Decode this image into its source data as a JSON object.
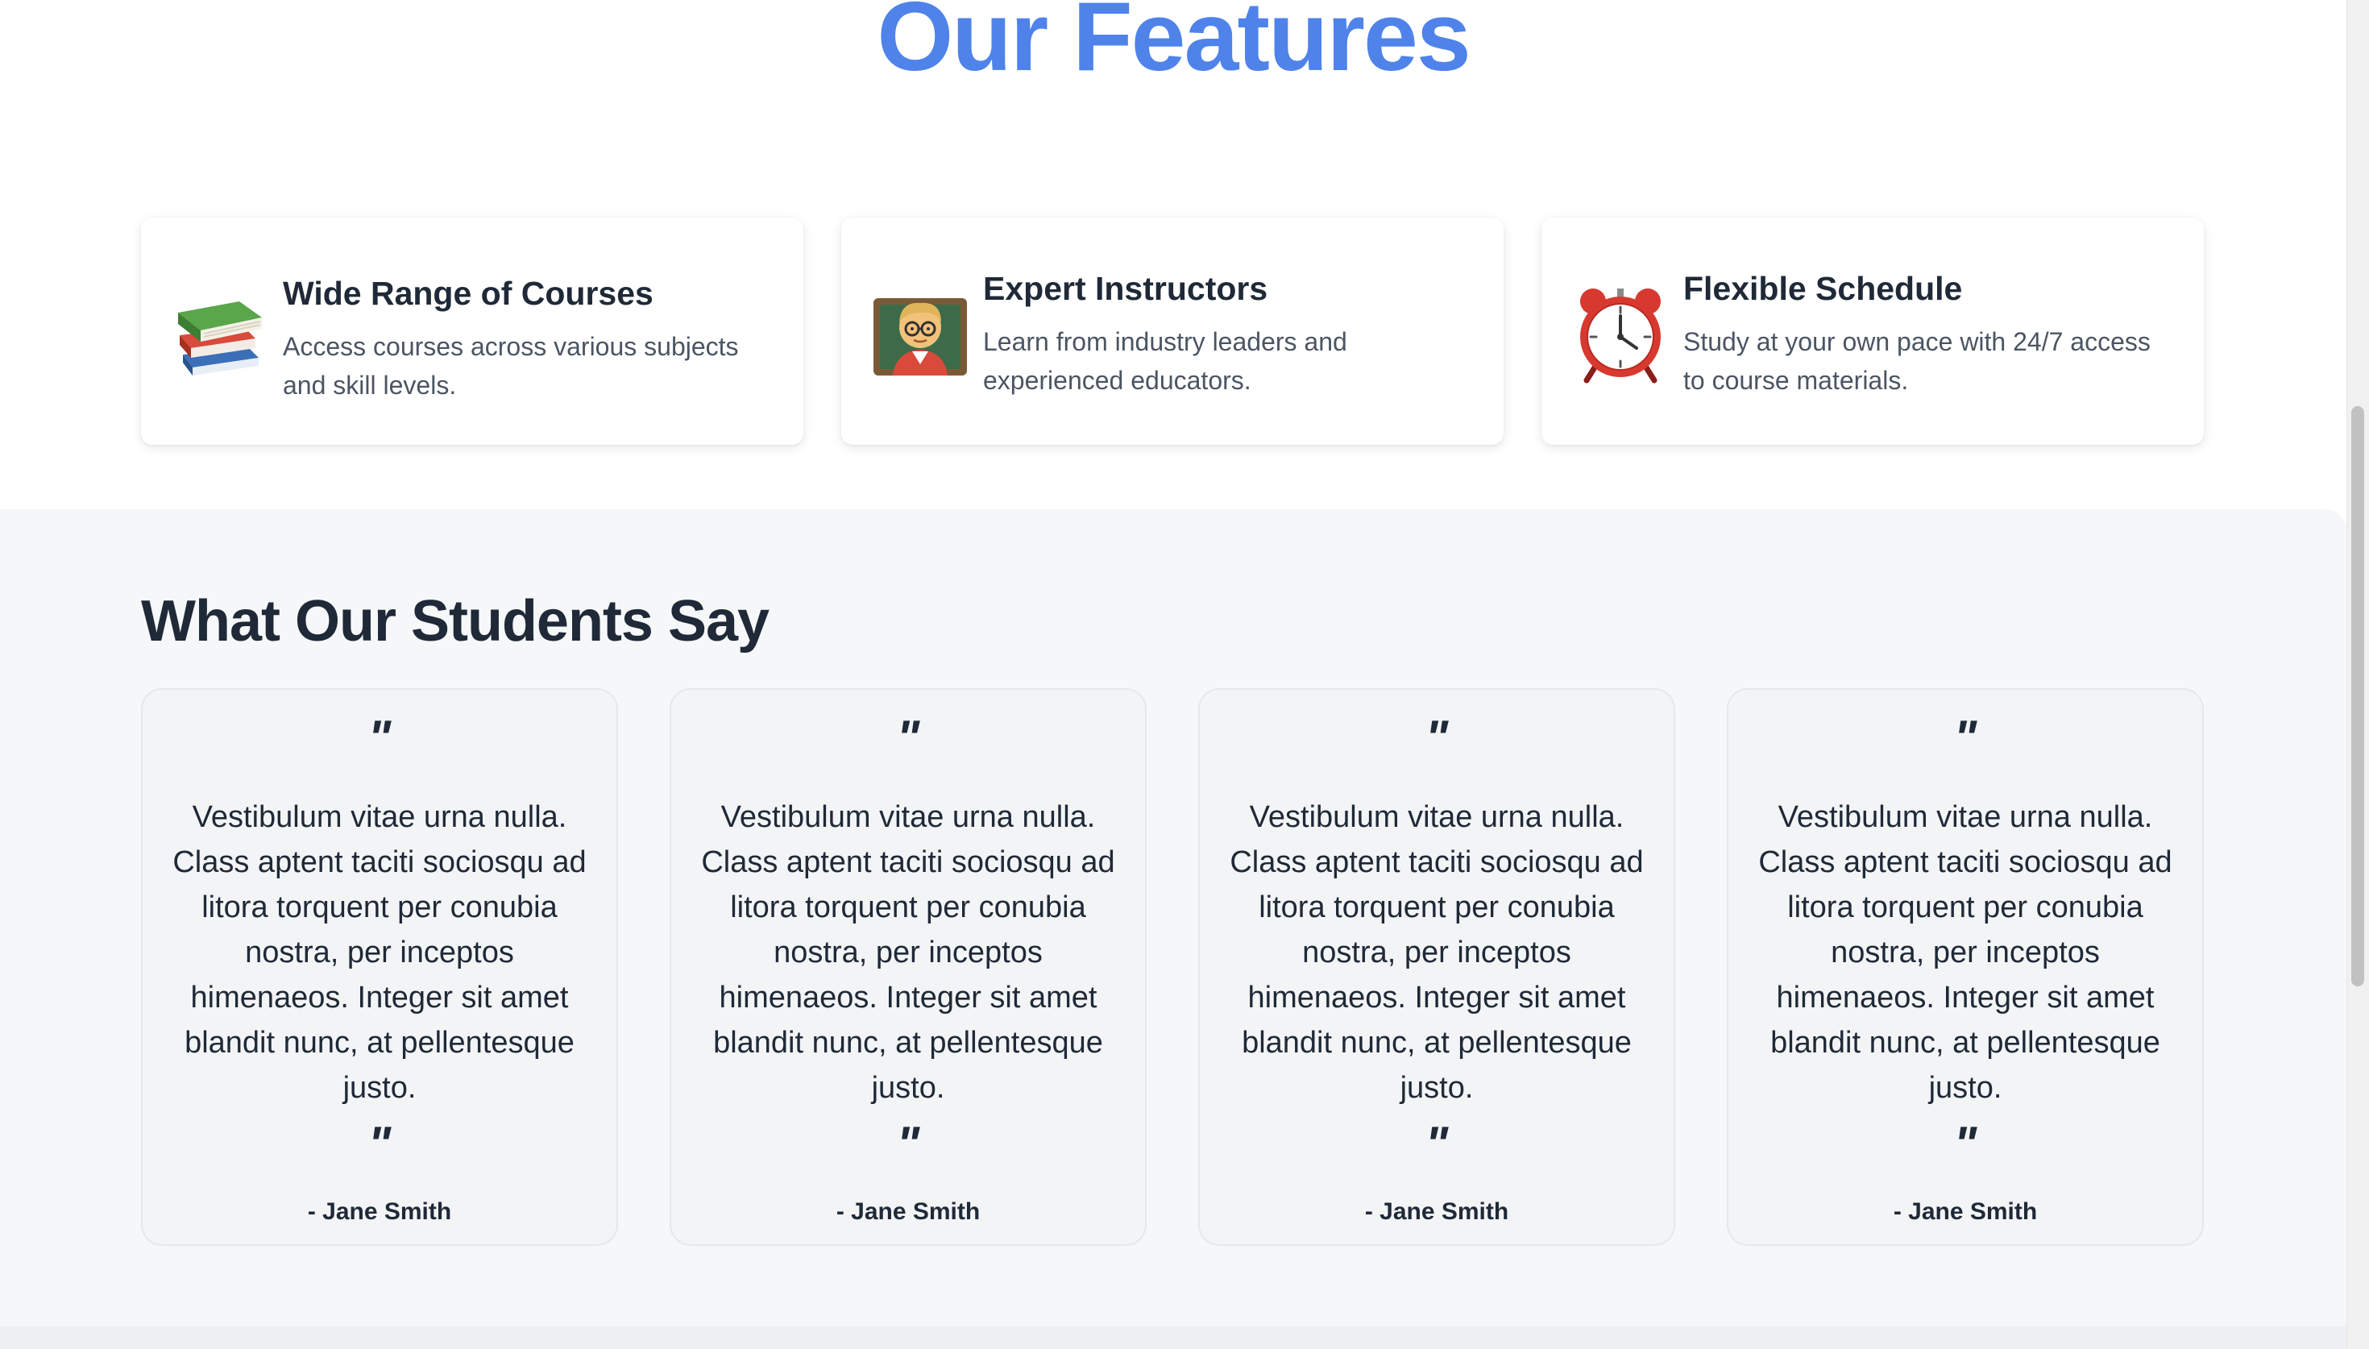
{
  "features": {
    "title": "Our Features",
    "items": [
      {
        "icon": "books-icon",
        "title": "Wide Range of Courses",
        "description": "Access courses across various subjects and skill levels."
      },
      {
        "icon": "teacher-icon",
        "title": "Expert Instructors",
        "description": "Learn from industry leaders and experienced educators."
      },
      {
        "icon": "alarm-clock-icon",
        "title": "Flexible Schedule",
        "description": "Study at your own pace with 24/7 access to course materials."
      }
    ]
  },
  "testimonials": {
    "title": "What Our Students Say",
    "open_quote": "\"",
    "close_quote": "\"",
    "items": [
      {
        "text": "Vestibulum vitae urna nulla. Class aptent taciti sociosqu ad litora torquent per conubia nostra, per inceptos himenaeos. Integer sit amet blandit nunc, at pellentesque justo.",
        "author": "- Jane Smith"
      },
      {
        "text": "Vestibulum vitae urna nulla. Class aptent taciti sociosqu ad litora torquent per conubia nostra, per inceptos himenaeos. Integer sit amet blandit nunc, at pellentesque justo.",
        "author": "- Jane Smith"
      },
      {
        "text": "Vestibulum vitae urna nulla. Class aptent taciti sociosqu ad litora torquent per conubia nostra, per inceptos himenaeos. Integer sit amet blandit nunc, at pellentesque justo.",
        "author": "- Jane Smith"
      },
      {
        "text": "Vestibulum vitae urna nulla. Class aptent taciti sociosqu ad litora torquent per conubia nostra, per inceptos himenaeos. Integer sit amet blandit nunc, at pellentesque justo.",
        "author": "- Jane Smith"
      }
    ]
  },
  "colors": {
    "accent": "#4f83ea",
    "heading": "#1f2937",
    "body_text": "#4b5563",
    "section_bg": "#f6f7f9",
    "card_bg": "#f3f4f6"
  }
}
